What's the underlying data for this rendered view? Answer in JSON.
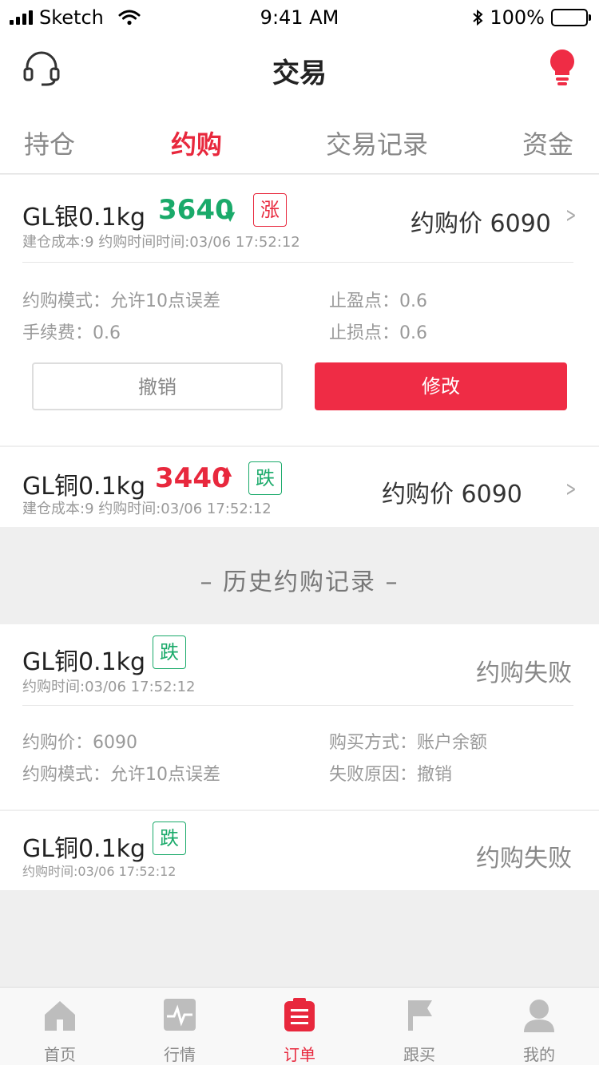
{
  "status_bar": {
    "carrier": "Sketch",
    "time": "9:41 AM",
    "battery": "100%"
  },
  "header": {
    "title": "交易",
    "left_icon": "headset-icon",
    "right_icon": "lightbulb-icon",
    "accent": "#e8283d"
  },
  "tabs": [
    {
      "label": "持仓",
      "active": false
    },
    {
      "label": "约购",
      "active": true
    },
    {
      "label": "交易记录",
      "active": false
    },
    {
      "label": "资金",
      "active": false
    }
  ],
  "orders": [
    {
      "name": "GL银0.1kg",
      "price": "3640",
      "direction": "down",
      "badge": "涨",
      "subtitle": "建仓成本:9 约购时间时间:03/06 17:52:12",
      "target_price": "约购价 6090",
      "details": [
        "约购模式：允许10点误差",
        "止盈点：0.6",
        "手续费：0.6",
        "止损点：0.6"
      ],
      "cancel_label": "撤销",
      "modify_label": "修改"
    },
    {
      "name": "GL铜0.1kg",
      "price": "3440",
      "direction": "up",
      "badge": "跌",
      "subtitle": "建仓成本:9 约购时间:03/06 17:52:12",
      "target_price": "约购价 6090"
    }
  ],
  "history": {
    "title": "– 历史约购记录 –",
    "items": [
      {
        "name": "GL铜0.1kg",
        "badge": "跌",
        "subtitle": "约购时间:03/06 17:52:12",
        "status": "约购失败",
        "details": [
          "约购价：6090",
          "购买方式：账户余额",
          "约购模式：允许10点误差",
          "失败原因：撤销"
        ]
      },
      {
        "name": "GL铜0.1kg",
        "badge": "跌",
        "subtitle": "约购时间:03/06 17:52:12",
        "status": "约购失败"
      }
    ]
  },
  "bottom_nav": [
    {
      "label": "首页",
      "icon": "home-icon",
      "active": false
    },
    {
      "label": "行情",
      "icon": "chart-icon",
      "active": false
    },
    {
      "label": "订单",
      "icon": "clipboard-icon",
      "active": true
    },
    {
      "label": "跟买",
      "icon": "flag-icon",
      "active": false
    },
    {
      "label": "我的",
      "icon": "user-icon",
      "active": false
    }
  ]
}
